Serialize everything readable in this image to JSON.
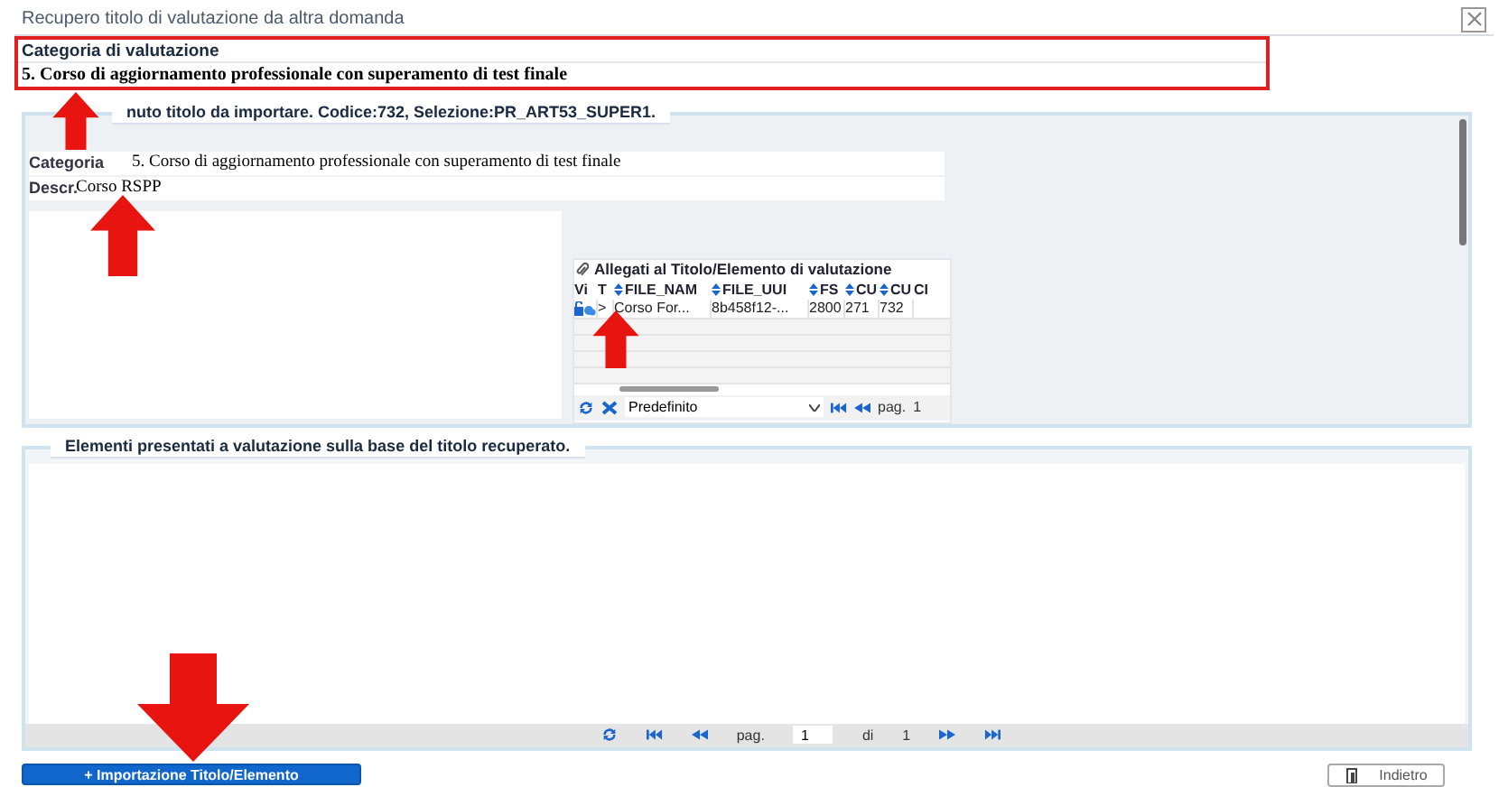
{
  "window": {
    "title": "Recupero titolo di valutazione da altra domanda"
  },
  "evaluation_category": {
    "label": "Categoria di valutazione",
    "value": "5. Corso di aggiornamento professionale con superamento di test finale"
  },
  "import_panel": {
    "legend": "nuto titolo da importare. Codice:732, Selezione:PR_ART53_SUPER1.",
    "fields": [
      {
        "label": "Categoria",
        "value": "5. Corso di aggiornamento professionale con superamento di test finale"
      },
      {
        "label": "Descr.",
        "value": "Corso RSPP"
      }
    ],
    "attachments": {
      "title": "Allegati al Titolo/Elemento di valutazione",
      "columns": [
        {
          "label": "Vi",
          "sortable": false
        },
        {
          "label": "T",
          "sortable": false
        },
        {
          "label": "FILE_NAM",
          "sortable": true
        },
        {
          "label": "FILE_UUI",
          "sortable": true
        },
        {
          "label": "FS",
          "sortable": true
        },
        {
          "label": "CU",
          "sortable": true
        },
        {
          "label": "CU",
          "sortable": true
        },
        {
          "label": "CI",
          "sortable": false
        }
      ],
      "rows": [
        {
          "cells": [
            "",
            ">",
            "Corso For...",
            "8b458f12-...",
            "2800",
            "271",
            "732",
            ""
          ]
        }
      ],
      "pager": {
        "view": "Predefinito",
        "page_label": "pag.",
        "page": "1"
      }
    }
  },
  "elements_panel": {
    "legend": "Elementi presentati a valutazione sulla base del titolo recuperato.",
    "pager": {
      "page_label": "pag.",
      "page": "1",
      "of_label": "di",
      "total": "1"
    }
  },
  "buttons": [
    {
      "label": "+ Importazione Titolo/Elemento",
      "kind": "primary"
    },
    {
      "label": "Indietro",
      "kind": "secondary"
    }
  ]
}
